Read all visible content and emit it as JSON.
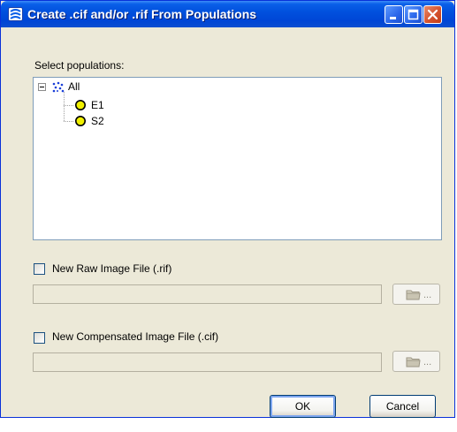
{
  "window": {
    "title": "Create .cif and/or .rif From Populations",
    "icons": {
      "app": "window-app-icon",
      "minimize": "minimize-icon",
      "maximize": "maximize-icon",
      "close": "close-icon"
    }
  },
  "populations": {
    "label": "Select populations:",
    "tree": {
      "root": {
        "label": "All",
        "icon": "population-dots-icon",
        "expander": "minus",
        "expanded": true
      },
      "children": [
        {
          "label": "E1",
          "icon": "yellow-circle-icon",
          "color": "#f0f000"
        },
        {
          "label": "S2",
          "icon": "yellow-circle-icon",
          "color": "#f0f000"
        }
      ]
    }
  },
  "raw_image": {
    "checkbox_label": "New Raw Image File (.rif)",
    "checked": false,
    "path_value": "",
    "browse_icon": "folder-icon",
    "browse_text": "..."
  },
  "compensated_image": {
    "checkbox_label": "New Compensated Image File (.cif)",
    "checked": false,
    "path_value": "",
    "browse_icon": "folder-icon",
    "browse_text": "..."
  },
  "buttons": {
    "ok": "OK",
    "cancel": "Cancel"
  },
  "colors": {
    "title_bar": "#0151de",
    "dialog_bg": "#ece9d8",
    "tree_border": "#7f9db9",
    "close_button": "#d5532e"
  }
}
